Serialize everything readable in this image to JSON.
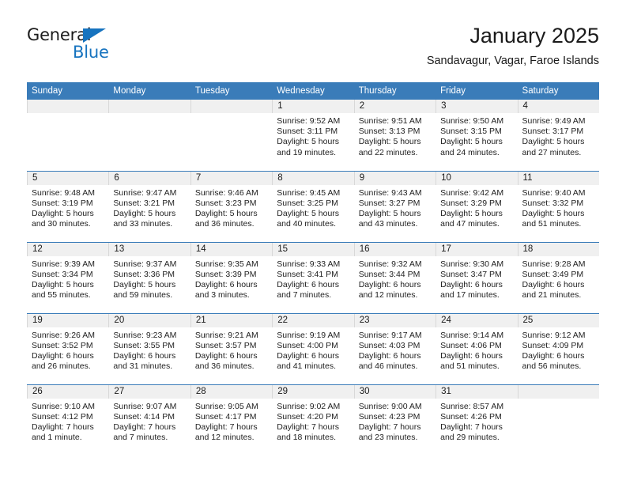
{
  "brand": {
    "name_primary": "General",
    "name_secondary": "Blue",
    "primary_color": "#1c1c1c",
    "accent_color": "#1673bf"
  },
  "header": {
    "title": "January 2025",
    "subtitle": "Sandavagur, Vagar, Faroe Islands"
  },
  "theme": {
    "header_bg": "#3a7cb9",
    "daynum_bg": "#f0f0f0",
    "week_divider": "#3a7cb9"
  },
  "calendar": {
    "month": "January",
    "year": "2025",
    "weekday_headers": [
      "Sunday",
      "Monday",
      "Tuesday",
      "Wednesday",
      "Thursday",
      "Friday",
      "Saturday"
    ],
    "weeks": [
      [
        {
          "day": "",
          "empty": true,
          "sunrise": "",
          "sunset": "",
          "daylight_line1": "",
          "daylight_line2": ""
        },
        {
          "day": "",
          "empty": true,
          "sunrise": "",
          "sunset": "",
          "daylight_line1": "",
          "daylight_line2": ""
        },
        {
          "day": "",
          "empty": true,
          "sunrise": "",
          "sunset": "",
          "daylight_line1": "",
          "daylight_line2": ""
        },
        {
          "day": "1",
          "empty": false,
          "sunrise": "Sunrise: 9:52 AM",
          "sunset": "Sunset: 3:11 PM",
          "daylight_line1": "Daylight: 5 hours",
          "daylight_line2": "and 19 minutes."
        },
        {
          "day": "2",
          "empty": false,
          "sunrise": "Sunrise: 9:51 AM",
          "sunset": "Sunset: 3:13 PM",
          "daylight_line1": "Daylight: 5 hours",
          "daylight_line2": "and 22 minutes."
        },
        {
          "day": "3",
          "empty": false,
          "sunrise": "Sunrise: 9:50 AM",
          "sunset": "Sunset: 3:15 PM",
          "daylight_line1": "Daylight: 5 hours",
          "daylight_line2": "and 24 minutes."
        },
        {
          "day": "4",
          "empty": false,
          "sunrise": "Sunrise: 9:49 AM",
          "sunset": "Sunset: 3:17 PM",
          "daylight_line1": "Daylight: 5 hours",
          "daylight_line2": "and 27 minutes."
        }
      ],
      [
        {
          "day": "5",
          "empty": false,
          "sunrise": "Sunrise: 9:48 AM",
          "sunset": "Sunset: 3:19 PM",
          "daylight_line1": "Daylight: 5 hours",
          "daylight_line2": "and 30 minutes."
        },
        {
          "day": "6",
          "empty": false,
          "sunrise": "Sunrise: 9:47 AM",
          "sunset": "Sunset: 3:21 PM",
          "daylight_line1": "Daylight: 5 hours",
          "daylight_line2": "and 33 minutes."
        },
        {
          "day": "7",
          "empty": false,
          "sunrise": "Sunrise: 9:46 AM",
          "sunset": "Sunset: 3:23 PM",
          "daylight_line1": "Daylight: 5 hours",
          "daylight_line2": "and 36 minutes."
        },
        {
          "day": "8",
          "empty": false,
          "sunrise": "Sunrise: 9:45 AM",
          "sunset": "Sunset: 3:25 PM",
          "daylight_line1": "Daylight: 5 hours",
          "daylight_line2": "and 40 minutes."
        },
        {
          "day": "9",
          "empty": false,
          "sunrise": "Sunrise: 9:43 AM",
          "sunset": "Sunset: 3:27 PM",
          "daylight_line1": "Daylight: 5 hours",
          "daylight_line2": "and 43 minutes."
        },
        {
          "day": "10",
          "empty": false,
          "sunrise": "Sunrise: 9:42 AM",
          "sunset": "Sunset: 3:29 PM",
          "daylight_line1": "Daylight: 5 hours",
          "daylight_line2": "and 47 minutes."
        },
        {
          "day": "11",
          "empty": false,
          "sunrise": "Sunrise: 9:40 AM",
          "sunset": "Sunset: 3:32 PM",
          "daylight_line1": "Daylight: 5 hours",
          "daylight_line2": "and 51 minutes."
        }
      ],
      [
        {
          "day": "12",
          "empty": false,
          "sunrise": "Sunrise: 9:39 AM",
          "sunset": "Sunset: 3:34 PM",
          "daylight_line1": "Daylight: 5 hours",
          "daylight_line2": "and 55 minutes."
        },
        {
          "day": "13",
          "empty": false,
          "sunrise": "Sunrise: 9:37 AM",
          "sunset": "Sunset: 3:36 PM",
          "daylight_line1": "Daylight: 5 hours",
          "daylight_line2": "and 59 minutes."
        },
        {
          "day": "14",
          "empty": false,
          "sunrise": "Sunrise: 9:35 AM",
          "sunset": "Sunset: 3:39 PM",
          "daylight_line1": "Daylight: 6 hours",
          "daylight_line2": "and 3 minutes."
        },
        {
          "day": "15",
          "empty": false,
          "sunrise": "Sunrise: 9:33 AM",
          "sunset": "Sunset: 3:41 PM",
          "daylight_line1": "Daylight: 6 hours",
          "daylight_line2": "and 7 minutes."
        },
        {
          "day": "16",
          "empty": false,
          "sunrise": "Sunrise: 9:32 AM",
          "sunset": "Sunset: 3:44 PM",
          "daylight_line1": "Daylight: 6 hours",
          "daylight_line2": "and 12 minutes."
        },
        {
          "day": "17",
          "empty": false,
          "sunrise": "Sunrise: 9:30 AM",
          "sunset": "Sunset: 3:47 PM",
          "daylight_line1": "Daylight: 6 hours",
          "daylight_line2": "and 17 minutes."
        },
        {
          "day": "18",
          "empty": false,
          "sunrise": "Sunrise: 9:28 AM",
          "sunset": "Sunset: 3:49 PM",
          "daylight_line1": "Daylight: 6 hours",
          "daylight_line2": "and 21 minutes."
        }
      ],
      [
        {
          "day": "19",
          "empty": false,
          "sunrise": "Sunrise: 9:26 AM",
          "sunset": "Sunset: 3:52 PM",
          "daylight_line1": "Daylight: 6 hours",
          "daylight_line2": "and 26 minutes."
        },
        {
          "day": "20",
          "empty": false,
          "sunrise": "Sunrise: 9:23 AM",
          "sunset": "Sunset: 3:55 PM",
          "daylight_line1": "Daylight: 6 hours",
          "daylight_line2": "and 31 minutes."
        },
        {
          "day": "21",
          "empty": false,
          "sunrise": "Sunrise: 9:21 AM",
          "sunset": "Sunset: 3:57 PM",
          "daylight_line1": "Daylight: 6 hours",
          "daylight_line2": "and 36 minutes."
        },
        {
          "day": "22",
          "empty": false,
          "sunrise": "Sunrise: 9:19 AM",
          "sunset": "Sunset: 4:00 PM",
          "daylight_line1": "Daylight: 6 hours",
          "daylight_line2": "and 41 minutes."
        },
        {
          "day": "23",
          "empty": false,
          "sunrise": "Sunrise: 9:17 AM",
          "sunset": "Sunset: 4:03 PM",
          "daylight_line1": "Daylight: 6 hours",
          "daylight_line2": "and 46 minutes."
        },
        {
          "day": "24",
          "empty": false,
          "sunrise": "Sunrise: 9:14 AM",
          "sunset": "Sunset: 4:06 PM",
          "daylight_line1": "Daylight: 6 hours",
          "daylight_line2": "and 51 minutes."
        },
        {
          "day": "25",
          "empty": false,
          "sunrise": "Sunrise: 9:12 AM",
          "sunset": "Sunset: 4:09 PM",
          "daylight_line1": "Daylight: 6 hours",
          "daylight_line2": "and 56 minutes."
        }
      ],
      [
        {
          "day": "26",
          "empty": false,
          "sunrise": "Sunrise: 9:10 AM",
          "sunset": "Sunset: 4:12 PM",
          "daylight_line1": "Daylight: 7 hours",
          "daylight_line2": "and 1 minute."
        },
        {
          "day": "27",
          "empty": false,
          "sunrise": "Sunrise: 9:07 AM",
          "sunset": "Sunset: 4:14 PM",
          "daylight_line1": "Daylight: 7 hours",
          "daylight_line2": "and 7 minutes."
        },
        {
          "day": "28",
          "empty": false,
          "sunrise": "Sunrise: 9:05 AM",
          "sunset": "Sunset: 4:17 PM",
          "daylight_line1": "Daylight: 7 hours",
          "daylight_line2": "and 12 minutes."
        },
        {
          "day": "29",
          "empty": false,
          "sunrise": "Sunrise: 9:02 AM",
          "sunset": "Sunset: 4:20 PM",
          "daylight_line1": "Daylight: 7 hours",
          "daylight_line2": "and 18 minutes."
        },
        {
          "day": "30",
          "empty": false,
          "sunrise": "Sunrise: 9:00 AM",
          "sunset": "Sunset: 4:23 PM",
          "daylight_line1": "Daylight: 7 hours",
          "daylight_line2": "and 23 minutes."
        },
        {
          "day": "31",
          "empty": false,
          "sunrise": "Sunrise: 8:57 AM",
          "sunset": "Sunset: 4:26 PM",
          "daylight_line1": "Daylight: 7 hours",
          "daylight_line2": "and 29 minutes."
        },
        {
          "day": "",
          "empty": true,
          "sunrise": "",
          "sunset": "",
          "daylight_line1": "",
          "daylight_line2": ""
        }
      ]
    ]
  }
}
